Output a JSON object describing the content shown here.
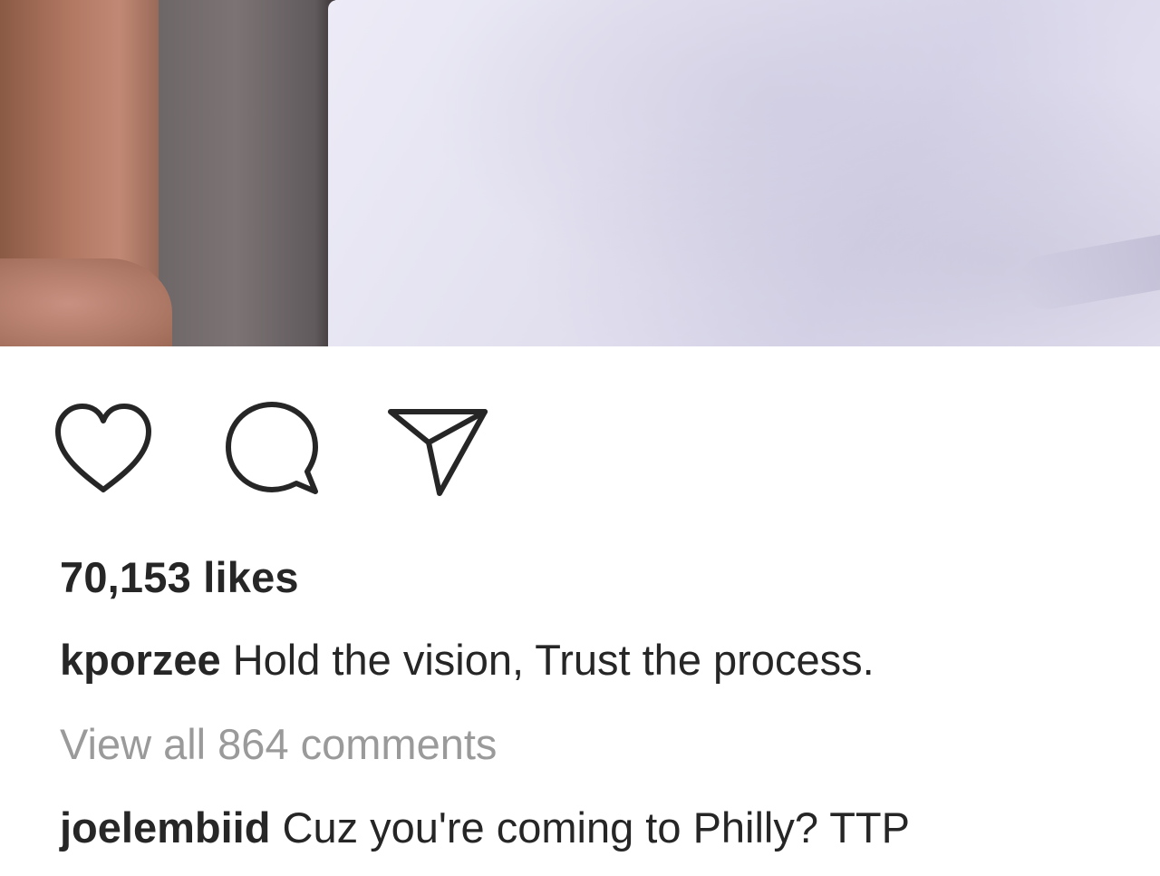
{
  "post": {
    "likes_text": "70,153 likes",
    "caption": {
      "username": "kporzee",
      "text": "Hold the vision, Trust the process."
    },
    "view_comments_text": "View all 864 comments",
    "comments": [
      {
        "username": "joelembiid",
        "text": "Cuz you're coming to Philly? TTP"
      }
    ]
  },
  "actions": {
    "icons": [
      "heart-icon",
      "comment-icon",
      "share-icon"
    ]
  },
  "colors": {
    "text": "#262626",
    "muted_text": "#9a9a9a",
    "background": "#ffffff"
  }
}
